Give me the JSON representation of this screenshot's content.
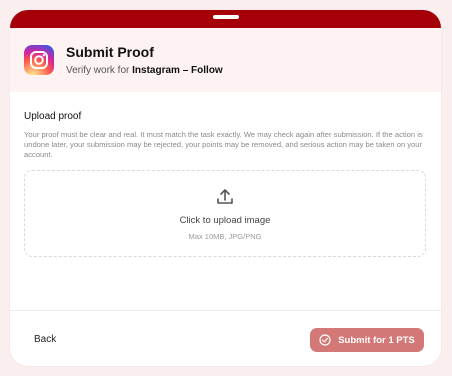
{
  "header": {
    "title": "Submit Proof",
    "subtitle_prefix": "Verify work for ",
    "task_name": "Instagram – Follow",
    "app_icon": "instagram-logo"
  },
  "upload": {
    "title": "Upload proof",
    "description": "Your proof must be clear and real. It must match the task exactly. We may check again after submission. If the action is undone later, your submission may be rejected, your points may be removed, and serious action may be taken on your account.",
    "dropzone_label": "Click to upload image",
    "dropzone_hint": "Max 10MB, JPG/PNG",
    "icon": "upload-icon"
  },
  "footer": {
    "back_label": "Back",
    "submit_label": "Submit for 1 PTS",
    "submit_icon": "check-circle-icon"
  },
  "colors": {
    "accent": "#a50007",
    "submit_bg": "#d47777",
    "header_bg": "#fdf3f3",
    "page_bg": "#fbeeee"
  }
}
